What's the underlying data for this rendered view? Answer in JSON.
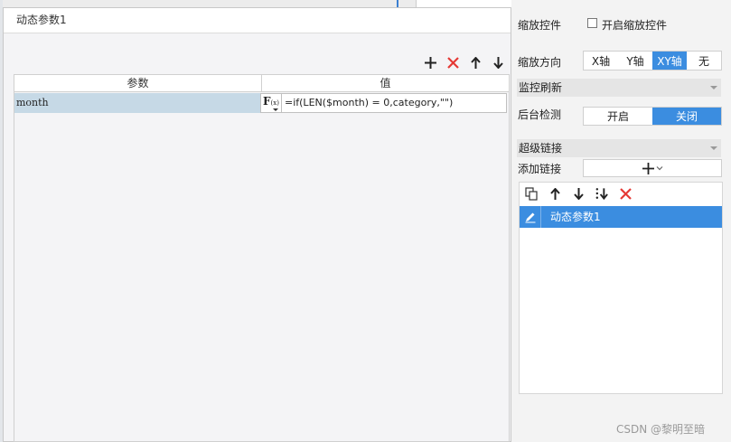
{
  "dialog": {
    "title": "动态参数1",
    "toolbar": {
      "add_icon": "plus-icon",
      "delete_icon": "delete-x-icon",
      "up_icon": "arrow-up-icon",
      "down_icon": "arrow-down-icon"
    },
    "table": {
      "headers": [
        "参数",
        "值"
      ],
      "rows": [
        {
          "name": "month",
          "fx_label": "F",
          "fx_sub": "(x)",
          "value": "=if(LEN($month) = 0,category,\"\")"
        }
      ]
    }
  },
  "panel": {
    "zoom_control_label": "缩放控件",
    "enable_zoom_label": "开启缩放控件",
    "enable_zoom_checked": false,
    "zoom_direction_label": "缩放方向",
    "zoom_direction_options": [
      "X轴",
      "Y轴",
      "XY轴",
      "无"
    ],
    "zoom_direction_selected": "XY轴",
    "monitor_refresh_label": "监控刷新",
    "background_check_label": "后台检测",
    "background_check_options": [
      "开启",
      "关闭"
    ],
    "background_check_selected": "关闭",
    "hyperlink_label": "超级链接",
    "add_link_label": "添加链接",
    "link_list": {
      "toolbar_icons": [
        "copy-icon",
        "arrow-up-icon",
        "arrow-down-icon",
        "move-bottom-icon",
        "delete-x-icon"
      ],
      "items": [
        {
          "label": "动态参数1",
          "selected": true
        }
      ]
    }
  },
  "colors": {
    "accent": "#3b8de0",
    "delete": "#e53935",
    "selected_row": "#c6d9e6"
  },
  "watermark": "CSDN @黎明至暗"
}
